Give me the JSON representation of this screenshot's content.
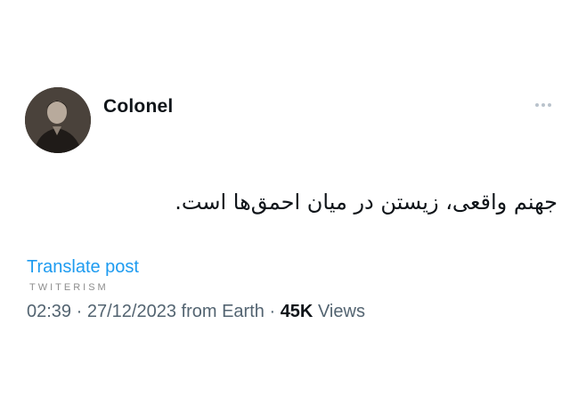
{
  "tweet": {
    "author": {
      "display_name": "Colonel",
      "avatar_icon": "user-avatar-photo"
    },
    "more_icon": "more-dots-icon",
    "text": "جهنم واقعی، زیستن در میان احمق‌ها است.",
    "translate_label": "Translate post",
    "watermark": "TWITERISM",
    "meta": {
      "time": "02:39",
      "separator": "·",
      "date": "27/12/2023",
      "source": "from Earth",
      "views_count": "45K",
      "views_label": "Views"
    }
  },
  "colors": {
    "link": "#1d9bf0",
    "meta_text": "#536471",
    "primary_text": "#0f1419"
  }
}
